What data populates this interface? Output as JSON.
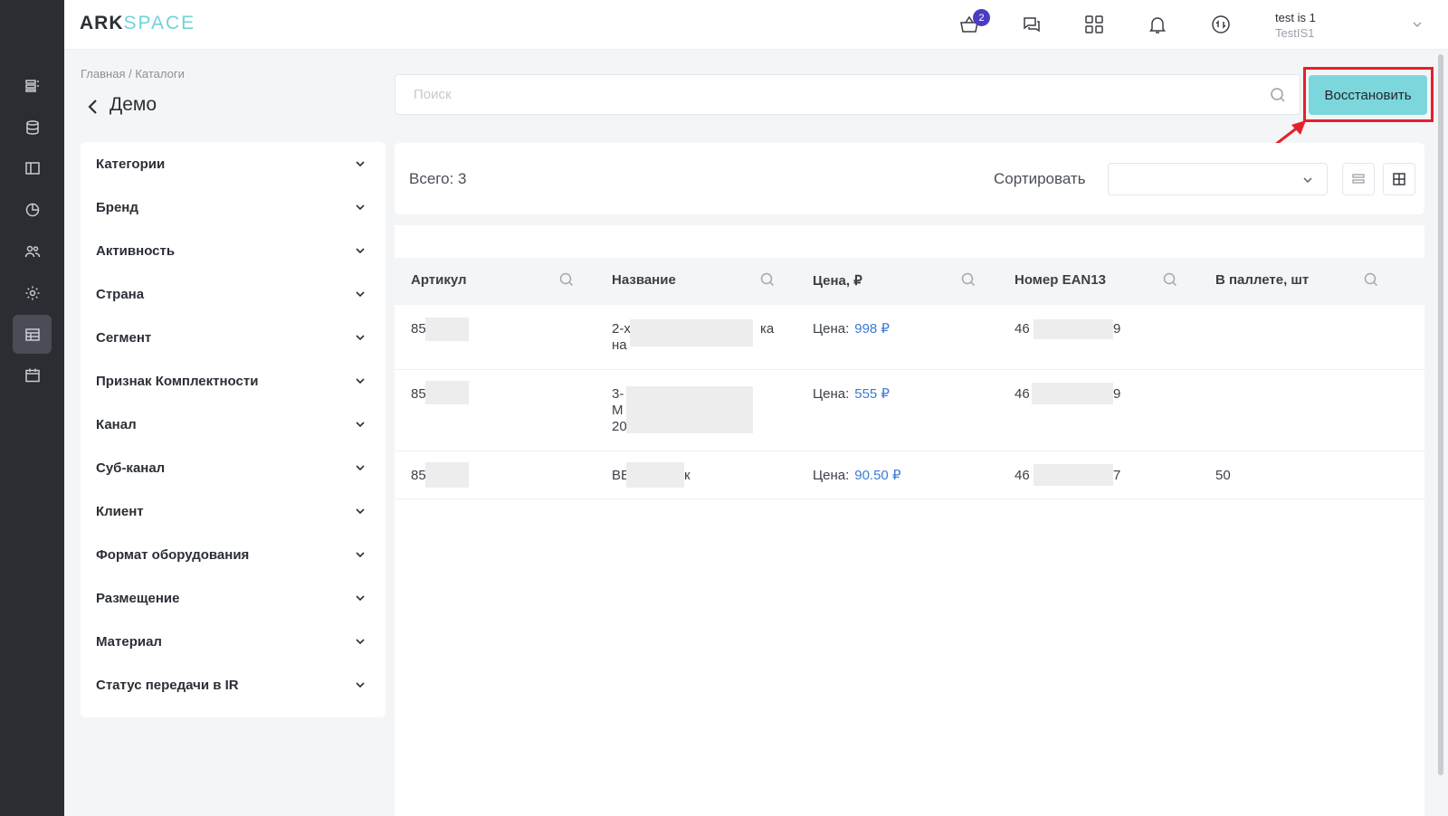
{
  "app": {
    "logo_part1": "ARK",
    "logo_part2": "SPACE"
  },
  "header": {
    "cart_badge": "2",
    "user_name": "test is 1",
    "user_org": "TestIS1",
    "icons": [
      "cart-icon",
      "chat-icon",
      "apps-grid-icon",
      "bell-icon",
      "sync-icon"
    ]
  },
  "sidebar": {
    "items": [
      {
        "name": "dashboard-icon"
      },
      {
        "name": "database-icon"
      },
      {
        "name": "layout-icon"
      },
      {
        "name": "chart-icon"
      },
      {
        "name": "users-icon"
      },
      {
        "name": "settings-icon"
      },
      {
        "name": "catalog-icon",
        "active": true
      },
      {
        "name": "calendar-icon"
      }
    ]
  },
  "breadcrumb": "Главная / Каталоги",
  "page_title": "Демо",
  "search": {
    "placeholder": "Поиск",
    "value": ""
  },
  "restore_button": "Восстановить",
  "filters": [
    "Категории",
    "Бренд",
    "Активность",
    "Страна",
    "Сегмент",
    "Признак Комплектности",
    "Канал",
    "Суб-канал",
    "Клиент",
    "Формат оборудования",
    "Размещение",
    "Материал",
    "Статус передачи в IR"
  ],
  "toolbar": {
    "total": "Всего: 3",
    "sort_label": "Сортировать",
    "sort_value": ""
  },
  "table": {
    "columns": [
      "Артикул",
      "Название",
      "Цена, ₽",
      "Номер EAN13",
      "В паллете, шт"
    ],
    "rows": [
      {
        "article": "85",
        "name_l1": "2-х",
        "name_l1_end": "ка",
        "name_l2": "на",
        "price_label": "Цена:",
        "price": "998 ₽",
        "ean_start": "46",
        "ean_end": "9",
        "pallet": ""
      },
      {
        "article": "85",
        "name_l1": "3-",
        "name_l2": "М",
        "name_l3": "20",
        "price_label": "Цена:",
        "price": "555 ₽",
        "ean_start": "46",
        "ean_end": "9",
        "pallet": ""
      },
      {
        "article": "85",
        "name_l1": "ВЕ",
        "name_l1_end": "к",
        "price_label": "Цена:",
        "price": "90.50 ₽",
        "ean_start": "46",
        "ean_end": "7",
        "pallet": "50"
      }
    ]
  },
  "colors": {
    "sidebar_bg": "#2b2d33",
    "accent_teal": "#7cd7dd",
    "price_blue": "#3a7bd5",
    "badge_purple": "#4c3cc5",
    "highlight_red": "#e5202a"
  }
}
